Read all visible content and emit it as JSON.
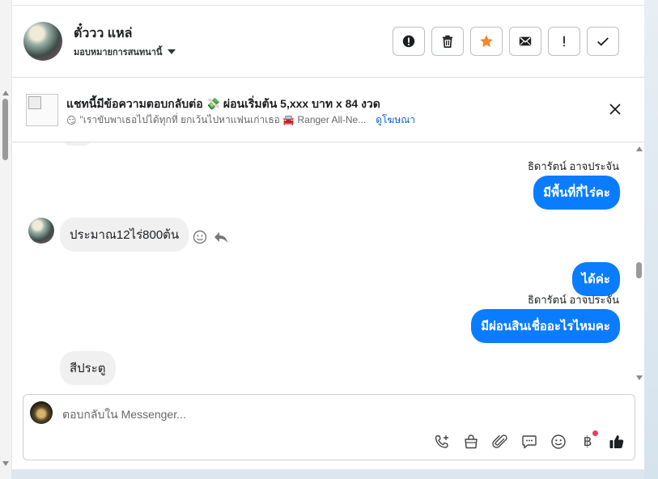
{
  "header": {
    "name": "ตั๋ววว แหล่",
    "assign_label": "มอบหมายการสนทนานี้",
    "actions": [
      {
        "name": "report-button",
        "icon": "alert-circle-icon"
      },
      {
        "name": "delete-button",
        "icon": "trash-icon"
      },
      {
        "name": "star-button",
        "icon": "star-icon",
        "color": "#f5842a"
      },
      {
        "name": "mark-unread-button",
        "icon": "envelope-icon"
      },
      {
        "name": "important-button",
        "icon": "exclamation-icon"
      },
      {
        "name": "done-button",
        "icon": "check-icon"
      }
    ]
  },
  "ad": {
    "title": "แชทนี้มีข้อความตอบกลับต่อ 💸 ผ่อนเริ่มต้น 5,xxx บาท x 84 งวด",
    "subtitle": "\"เราขับพาเธอไปได้ทุกที่ ยกเว้นไปหาแฟนเก่าเธอ 🚘 Ranger All-Ne...",
    "emoji": "😏",
    "link": "ดูโฆษณา"
  },
  "messages": {
    "sender1": "ธิดารัตน์ อาจประจัน",
    "out1": "มีพื้นที่กี่ไร่คะ",
    "in1": "ประมาณ12ไร่800ต้น",
    "out2": "ได้ค่ะ",
    "sender2": "ธิดารัตน์ อาจประจัน",
    "out3": "มีผ่อนสินเชื่ออะไรไหมคะ",
    "in2": "สีประตู"
  },
  "composer": {
    "placeholder": "ตอบกลับใน Messenger...",
    "baht_symbol": "฿",
    "tools": [
      "phone-plus-icon",
      "shopping-bag-icon",
      "paperclip-icon",
      "chat-bubble-icon",
      "smiley-icon",
      "baht-icon",
      "thumbs-up-icon"
    ]
  },
  "colors": {
    "accent": "#0a7cff",
    "star": "#f5842a",
    "link": "#0a64c7",
    "notification_dot": "#e53e5a"
  }
}
